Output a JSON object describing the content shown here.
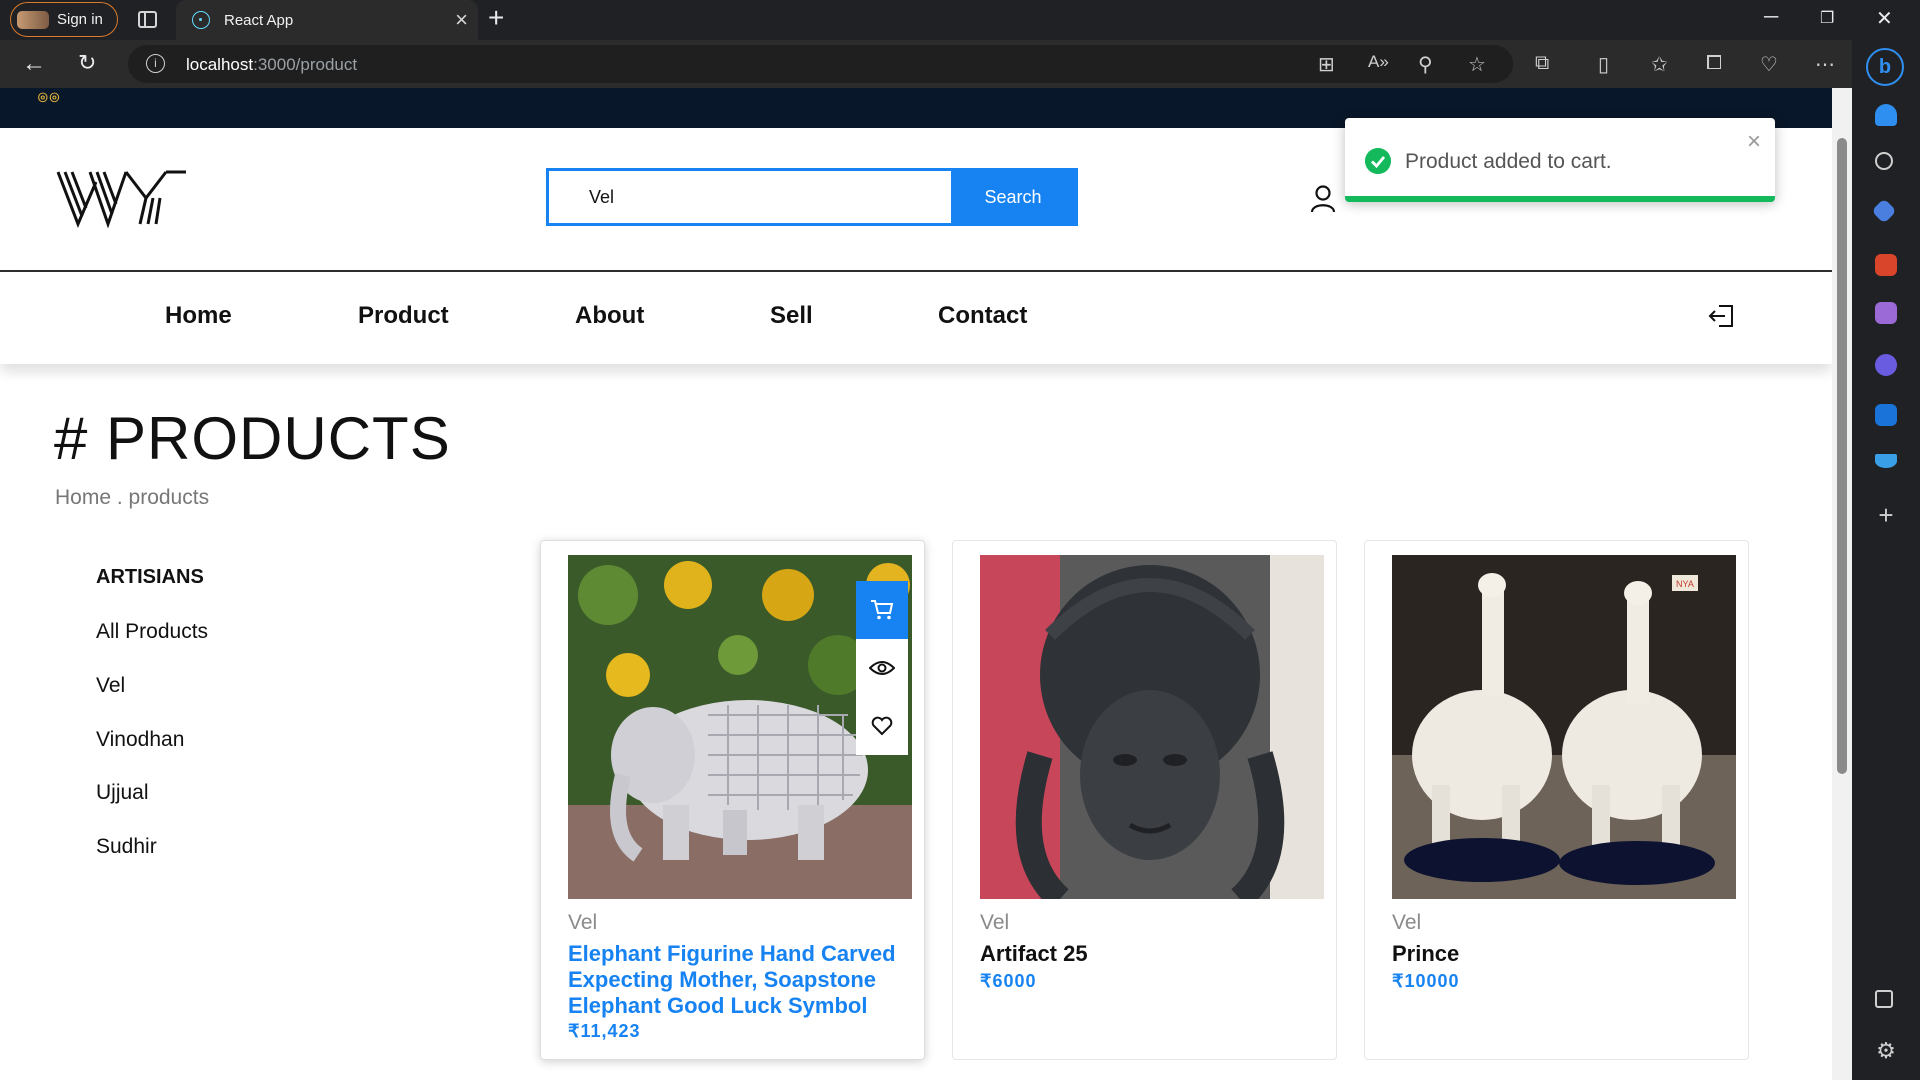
{
  "browser": {
    "signin_label": "Sign in",
    "tab_title": "React App",
    "url_host": "localhost",
    "url_path": ":3000/product"
  },
  "header": {
    "search_value": "Vel",
    "search_button": "Search"
  },
  "nav": {
    "items": [
      "Home",
      "Product",
      "About",
      "Sell",
      "Contact"
    ]
  },
  "page": {
    "heading": "# PRODUCTS",
    "breadcrumb": "Home . products"
  },
  "sidebar": {
    "title": "ARTISIANS",
    "items": [
      "All Products",
      "Vel",
      "Vinodhan",
      "Ujjual",
      "Sudhir"
    ]
  },
  "products": [
    {
      "vendor": "Vel",
      "title": "Elephant Figurine Hand Carved Expecting Mother, Soapstone Elephant Good Luck Symbol",
      "price": "₹11,423"
    },
    {
      "vendor": "Vel",
      "title": "Artifact 25",
      "price": "₹6000"
    },
    {
      "vendor": "Vel",
      "title": "Prince",
      "price": "₹10000"
    }
  ],
  "toast": {
    "message": "Product added to cart.",
    "status_color": "#13b95b"
  },
  "colors": {
    "accent": "#1783f2",
    "topstrip": "#09172a"
  }
}
